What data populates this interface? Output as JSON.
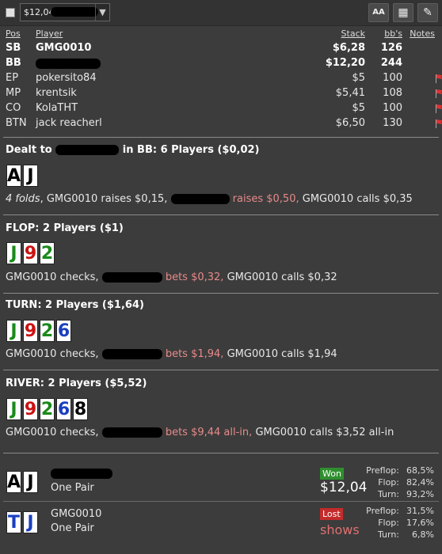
{
  "toolbar": {
    "hand_value": "$12,04",
    "font_btn": "AA",
    "grid_btn": "▦",
    "edit_btn": "✎"
  },
  "players_table": {
    "headers": {
      "pos": "Pos",
      "player": "Player",
      "stack": "Stack",
      "bbs": "bb's",
      "notes": "Notes"
    },
    "rows": [
      {
        "pos": "SB",
        "player": "GMG0010",
        "stack": "$6,28",
        "bbs": "126",
        "note": ""
      },
      {
        "pos": "BB",
        "player": "",
        "stack": "$12,20",
        "bbs": "244",
        "note": ""
      },
      {
        "pos": "EP",
        "player": "pokersito84",
        "stack": "$5",
        "bbs": "100",
        "note": "flag-icon"
      },
      {
        "pos": "MP",
        "player": "krentsik",
        "stack": "$5,41",
        "bbs": "108",
        "note": "flag-icon"
      },
      {
        "pos": "CO",
        "player": "KolaTHT",
        "stack": "$5",
        "bbs": "100",
        "note": "flag-icon"
      },
      {
        "pos": "BTN",
        "player": "jack reacherl",
        "stack": "$6,50",
        "bbs": "130",
        "note": "flag-icon"
      }
    ]
  },
  "preflop": {
    "title_pre": "Dealt to",
    "title_post": "in BB: 6 Players ($0,02)",
    "cards": [
      {
        "rank": "A",
        "suit": "s"
      },
      {
        "rank": "J",
        "suit": "s"
      }
    ],
    "action_1": "4 folds",
    "action_2": ", GMG0010 raises $0,15,",
    "action_3": "raises $0,50,",
    "action_4": "GMG0010 calls $0,35"
  },
  "flop": {
    "title": "FLOP: 2 Players ($1)",
    "cards": [
      {
        "rank": "J",
        "suit": "c"
      },
      {
        "rank": "9",
        "suit": "h"
      },
      {
        "rank": "2",
        "suit": "c"
      }
    ],
    "action_1": "GMG0010 checks,",
    "action_2": "bets $0,32,",
    "action_3": "GMG0010 calls $0,32"
  },
  "turn": {
    "title": "TURN: 2 Players ($1,64)",
    "cards": [
      {
        "rank": "J",
        "suit": "c"
      },
      {
        "rank": "9",
        "suit": "h"
      },
      {
        "rank": "2",
        "suit": "c"
      },
      {
        "rank": "6",
        "suit": "d"
      }
    ],
    "action_1": "GMG0010 checks,",
    "action_2": "bets $1,94,",
    "action_3": "GMG0010 calls $1,94"
  },
  "river": {
    "title": "RIVER: 2 Players ($5,52)",
    "cards": [
      {
        "rank": "J",
        "suit": "c"
      },
      {
        "rank": "9",
        "suit": "h"
      },
      {
        "rank": "2",
        "suit": "c"
      },
      {
        "rank": "6",
        "suit": "d"
      },
      {
        "rank": "8",
        "suit": "s"
      }
    ],
    "action_1": "GMG0010 checks,",
    "action_2": "bets $9,44 all-in,",
    "action_3": "GMG0010 calls $3,52 all-in"
  },
  "results": [
    {
      "name": "",
      "hand": "One Pair",
      "cards": [
        {
          "rank": "A",
          "suit": "s"
        },
        {
          "rank": "J",
          "suit": "s"
        }
      ],
      "badge": "Won",
      "amount": "$12,04",
      "equity": [
        {
          "label": "Preflop:",
          "value": "68,5%"
        },
        {
          "label": "Flop:",
          "value": "82,4%"
        },
        {
          "label": "Turn:",
          "value": "93,2%"
        }
      ]
    },
    {
      "name": "GMG0010",
      "hand": "One Pair",
      "cards": [
        {
          "rank": "T",
          "suit": "d"
        },
        {
          "rank": "J",
          "suit": "d"
        }
      ],
      "badge": "Lost",
      "amount": "shows",
      "equity": [
        {
          "label": "Preflop:",
          "value": "31,5%"
        },
        {
          "label": "Flop:",
          "value": "17,6%"
        },
        {
          "label": "Turn:",
          "value": "6,8%"
        }
      ]
    }
  ],
  "colors": {
    "background": "#3c3c3c",
    "bet_highlight": "#e88a8a",
    "won": "#2f8f2f",
    "lost": "#c42b2b"
  }
}
